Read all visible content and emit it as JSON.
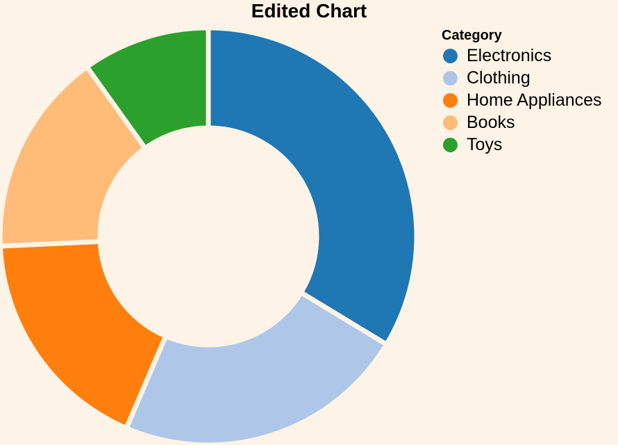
{
  "chart_data": {
    "type": "pie",
    "title": "Edited Chart",
    "legend_title": "Category",
    "legend_position": "top-right",
    "categories": [
      "Electronics",
      "Clothing",
      "Home Appliances",
      "Books",
      "Toys"
    ],
    "values": [
      34,
      23,
      18,
      16,
      10
    ],
    "colors": [
      "#1f77b4",
      "#aec7e8",
      "#ff7f0e",
      "#ffbb78",
      "#2ca02c"
    ],
    "hole_fraction": 0.52,
    "background_color": "#fdf3e6"
  }
}
